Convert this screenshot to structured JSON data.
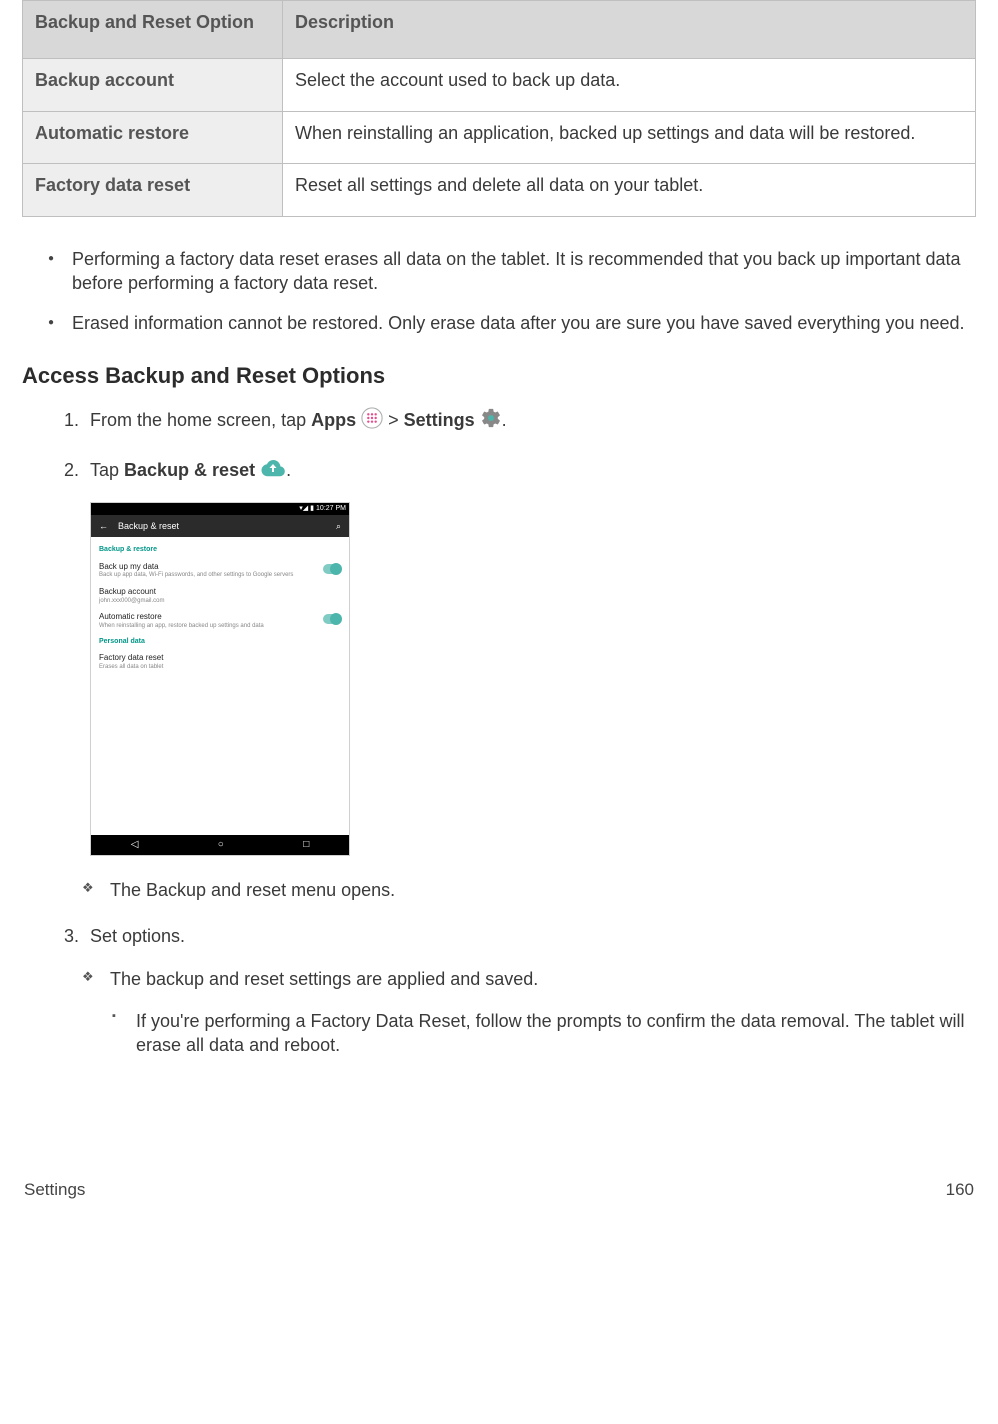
{
  "table": {
    "head": {
      "c1": "Backup and Reset Option",
      "c2": "Description"
    },
    "rows": [
      {
        "c1": "Backup account",
        "c2": "Select the account used to back up data."
      },
      {
        "c1": "Automatic restore",
        "c2": "When reinstalling an application, backed up settings and data will be restored."
      },
      {
        "c1": "Factory data reset",
        "c2": "Reset all settings and delete all data on your tablet."
      }
    ]
  },
  "warnings": {
    "w1": "Performing a factory data reset erases all data on the tablet. It is recommended that you back up important data before performing a factory data reset.",
    "w2": "Erased information cannot be restored. Only erase data after you are sure you have saved everything you need."
  },
  "heading": "Access Backup and Reset Options",
  "step1": {
    "pre": "From the home screen, tap ",
    "apps": "Apps",
    "gt": " > ",
    "settings": "Settings",
    "end": "."
  },
  "step2": {
    "pre": "Tap ",
    "label": "Backup & reset",
    "end": "."
  },
  "screenshot": {
    "statusbar_time": "10:27 PM",
    "appbar": {
      "back": "←",
      "title": "Backup & reset",
      "search": "⌕"
    },
    "section1": "Backup & restore",
    "r1": {
      "lbl": "Back up my data",
      "sub": "Back up app data, Wi-Fi passwords, and other settings to Google servers"
    },
    "r2": {
      "lbl": "Backup account",
      "sub": "john.xxx000@gmail.com"
    },
    "r3": {
      "lbl": "Automatic restore",
      "sub": "When reinstalling an app, restore backed up settings and data"
    },
    "section2": "Personal data",
    "r4": {
      "lbl": "Factory data reset",
      "sub": "Erases all data on tablet"
    },
    "nav": {
      "back": "◁",
      "home": "○",
      "recent": "□"
    }
  },
  "sub1": "The Backup and reset menu opens.",
  "step3": "Set options.",
  "sub2": "The backup and reset settings are applied and saved.",
  "sub3": "If you're performing a Factory Data Reset, follow the prompts to confirm the data removal. The tablet will erase all data and reboot.",
  "footer": {
    "left": "Settings",
    "right": "160"
  }
}
